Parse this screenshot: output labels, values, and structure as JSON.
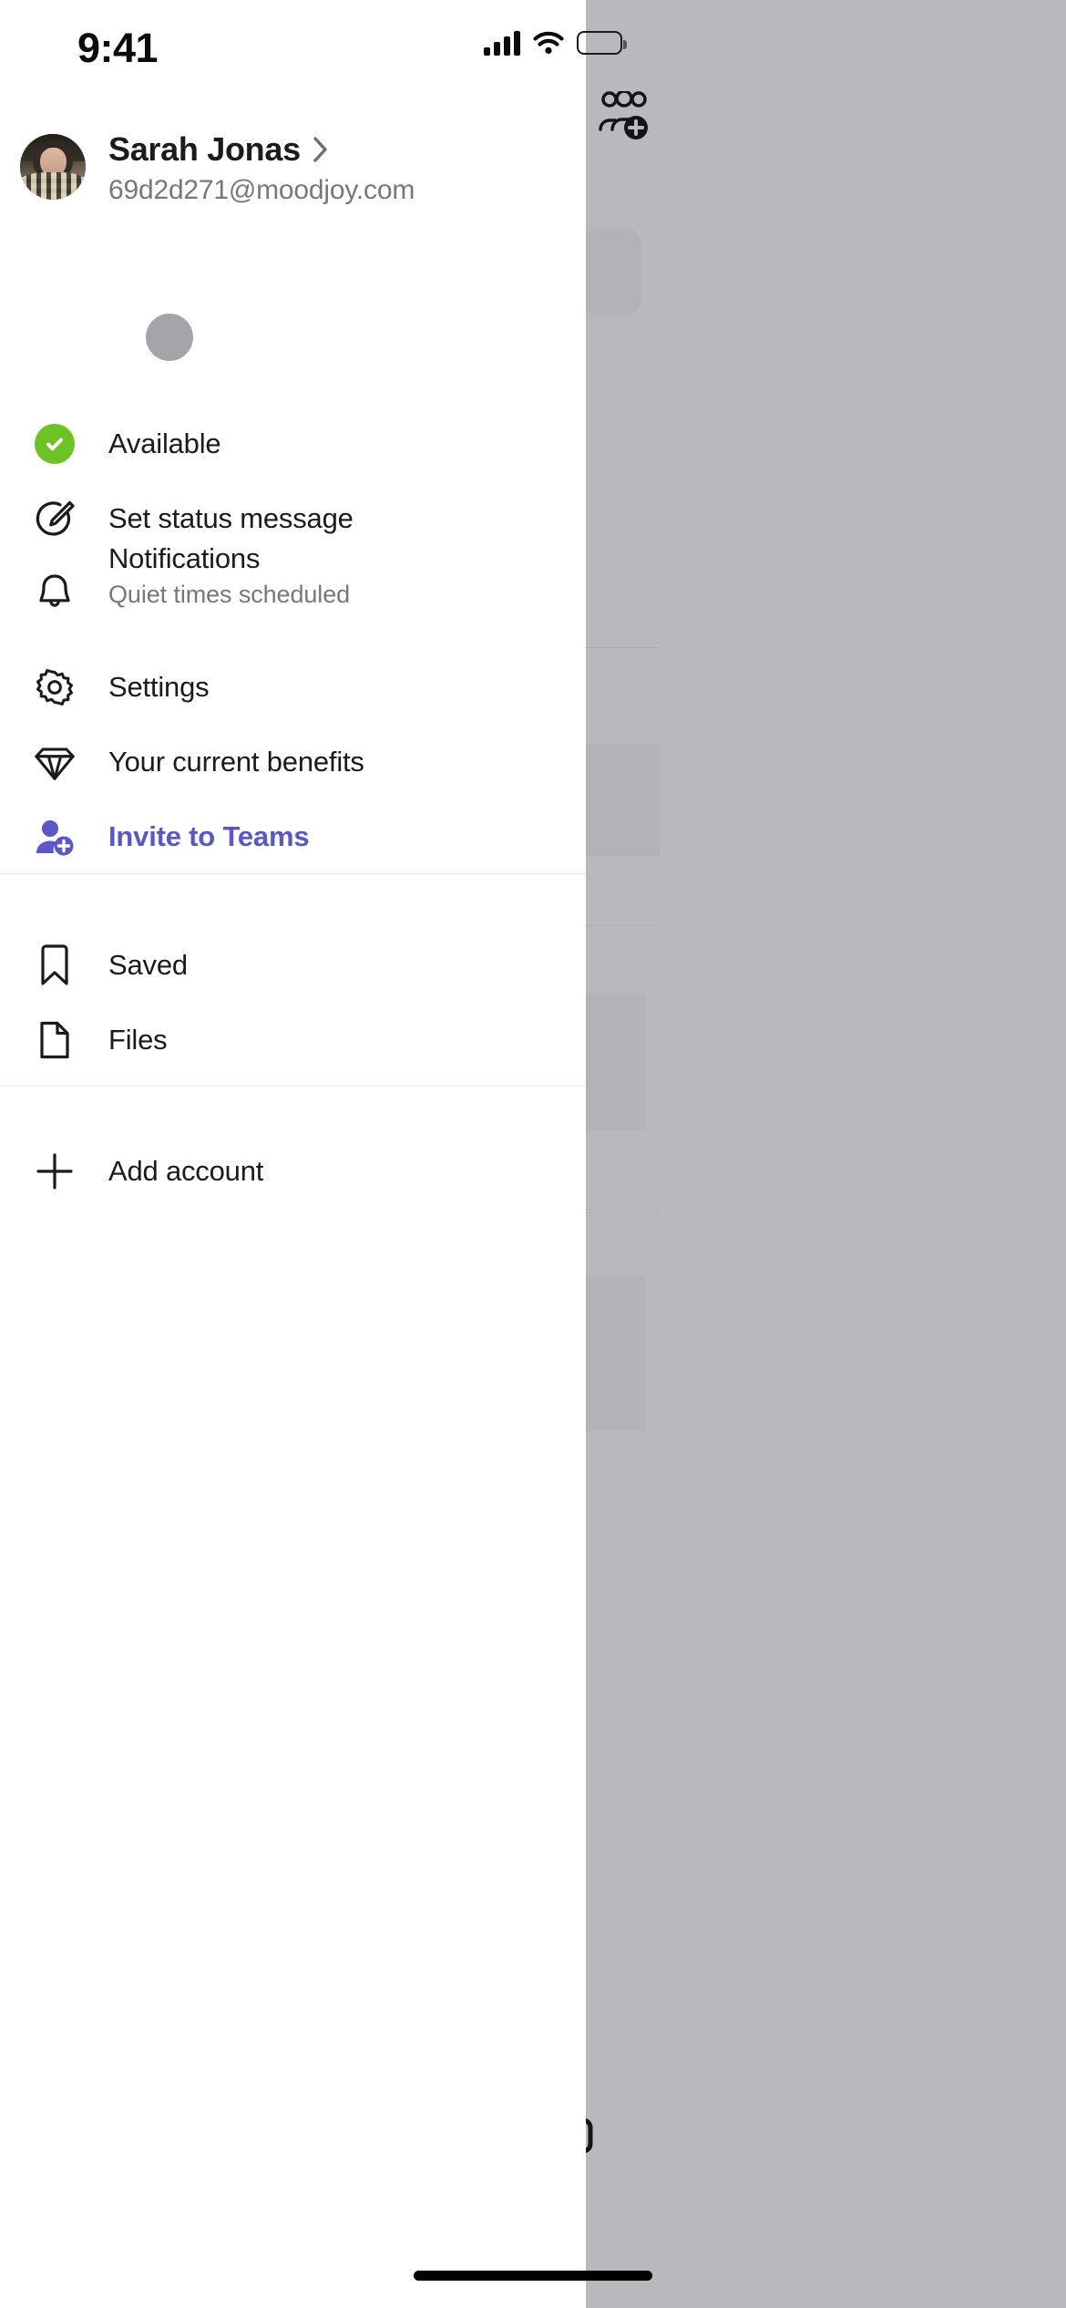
{
  "status_bar": {
    "time": "9:41",
    "icons": [
      "cellular-signal-icon",
      "wifi-icon",
      "battery-icon"
    ]
  },
  "profile": {
    "name": "Sarah Jonas",
    "email": "69d2d271@moodjoy.com",
    "avatar_alt": "Sarah Jonas profile photo",
    "chevron": "chevron-right-icon"
  },
  "menu": {
    "groups": [
      {
        "items": [
          {
            "id": "available",
            "label": "Available",
            "sublabel": "",
            "icon": "status-available-check-icon",
            "accent": false
          },
          {
            "id": "set-status-message",
            "label": "Set status message",
            "sublabel": "",
            "icon": "edit-pencil-circle-icon",
            "accent": false
          },
          {
            "id": "notifications",
            "label": "Notifications",
            "sublabel": "Quiet times scheduled",
            "icon": "bell-icon",
            "accent": false
          },
          {
            "id": "settings",
            "label": "Settings",
            "sublabel": "",
            "icon": "gear-icon",
            "accent": false
          },
          {
            "id": "your-current-benefits",
            "label": "Your current benefits",
            "sublabel": "",
            "icon": "diamond-icon",
            "accent": false
          },
          {
            "id": "invite-to-teams",
            "label": "Invite to Teams",
            "sublabel": "",
            "icon": "person-add-icon",
            "accent": true
          }
        ]
      },
      {
        "items": [
          {
            "id": "saved",
            "label": "Saved",
            "sublabel": "",
            "icon": "bookmark-icon",
            "accent": false
          },
          {
            "id": "files",
            "label": "Files",
            "sublabel": "",
            "icon": "file-document-icon",
            "accent": false
          }
        ]
      },
      {
        "items": [
          {
            "id": "add-account",
            "label": "Add account",
            "sublabel": "",
            "icon": "plus-icon",
            "accent": false
          }
        ]
      }
    ]
  },
  "backdrop": {
    "dimmed": true,
    "icons": [
      "add-people-group-icon",
      "chat-bubble-icon"
    ]
  },
  "colors": {
    "accent_purple": "#5a57c8",
    "status_available_green": "#6ec324",
    "text_primary": "#1b1b1f",
    "text_secondary": "#77777c",
    "divider": "#e6e6e8",
    "backdrop_scrim": "#b9b9bd",
    "panel_background": "#ffffff"
  }
}
